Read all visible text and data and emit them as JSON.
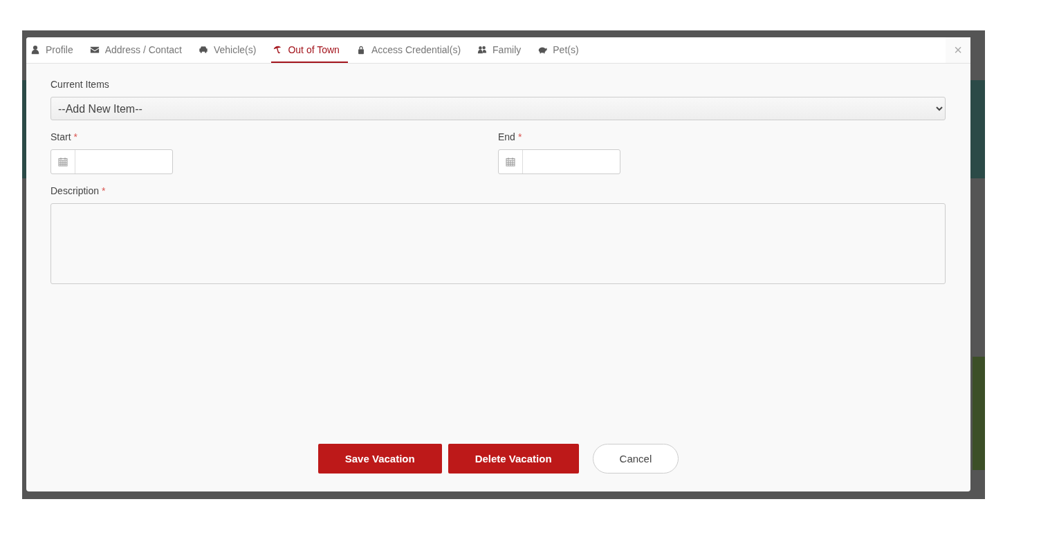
{
  "tabs": [
    {
      "label": "Profile",
      "selected": false
    },
    {
      "label": "Address / Contact",
      "selected": false
    },
    {
      "label": "Vehicle(s)",
      "selected": false
    },
    {
      "label": "Out of Town",
      "selected": true
    },
    {
      "label": "Access Credential(s)",
      "selected": false
    },
    {
      "label": "Family",
      "selected": false
    },
    {
      "label": "Pet(s)",
      "selected": false
    }
  ],
  "close": "×",
  "current_items": {
    "label": "Current Items",
    "value": "--Add New Item--"
  },
  "start": {
    "label": "Start",
    "required_mark": "*"
  },
  "end": {
    "label": "End",
    "required_mark": "*"
  },
  "description": {
    "label": "Description",
    "required_mark": "*"
  },
  "buttons": [
    {
      "label": "Save Vacation",
      "kind": "primary"
    },
    {
      "label": "Delete Vacation",
      "kind": "primary"
    },
    {
      "label": "Cancel",
      "kind": "secondary"
    }
  ]
}
